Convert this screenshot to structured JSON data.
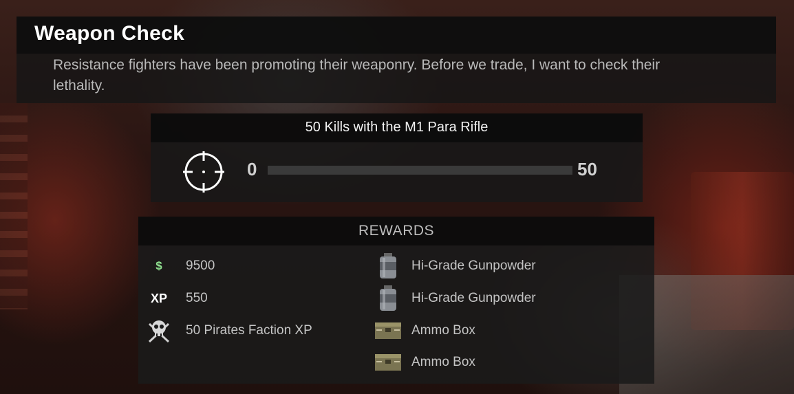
{
  "contract": {
    "title": "Weapon Check",
    "description": "Resistance fighters have been promoting their weaponry. Before we trade, I want to check their lethality."
  },
  "objective": {
    "title": "50 Kills with the M1 Para Rifle",
    "icon": "crosshair-icon",
    "progress_min": "0",
    "progress_max": "50",
    "progress_fraction": 0
  },
  "rewards": {
    "title": "REWARDS",
    "left": [
      {
        "icon": "money-icon",
        "icon_text": "$",
        "label": "9500"
      },
      {
        "icon": "xp-icon",
        "icon_text": "XP",
        "label": "550"
      },
      {
        "icon": "pirates-faction-icon",
        "label": "50 Pirates Faction XP"
      }
    ],
    "right": [
      {
        "icon": "gunpowder-canister-icon",
        "label": "Hi-Grade Gunpowder"
      },
      {
        "icon": "gunpowder-canister-icon",
        "label": "Hi-Grade Gunpowder"
      },
      {
        "icon": "ammo-box-icon",
        "label": "Ammo Box"
      },
      {
        "icon": "ammo-box-icon",
        "label": "Ammo Box"
      }
    ]
  },
  "colors": {
    "money": "#8fe08f",
    "panel": "#181818",
    "title_bar": "#0a0a0a"
  }
}
